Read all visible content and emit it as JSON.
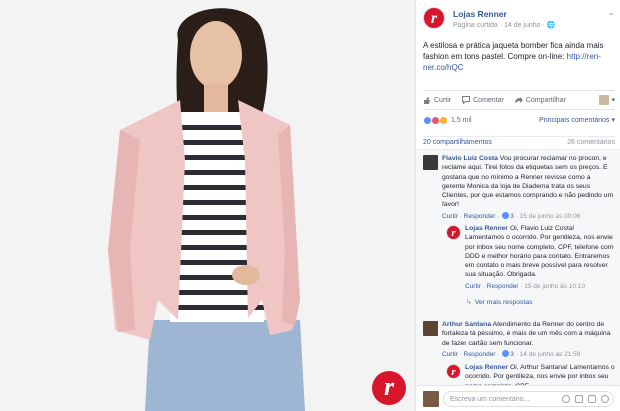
{
  "photo": {
    "brand_logo_letter": "r"
  },
  "post": {
    "page_name": "Lojas Renner",
    "page_avatar_letter": "r",
    "meta": "Página curtida · 14 de junho · 🌐",
    "text": "A estilosa e prática jaqueta bomber fica ainda mais fashion em tons pastel. Compre on-line: ",
    "link": "http://ren-ner.co/hQC"
  },
  "actions": {
    "like": "Curtir",
    "comment": "Comentar",
    "share": "Compartilhar"
  },
  "reactions": {
    "count": "1,5 mil",
    "sort": "Principais comentários ▾"
  },
  "stats": {
    "shares": "20 compartilhamentos",
    "comments": "26 comentários"
  },
  "comments": [
    {
      "author": "Flavio Luiz Costa",
      "text": "Vou procurar reclamar no procon, e reclame aqui. Tirei fotos da etiquetas sem os preços. E gostaria que no mínimo a Renner revisse como a gerente Monica da loja de Diadema trata os seus Clientes, por que estamos comprando e não pedindo um favor!",
      "like": "Curtir",
      "reply": "Responder",
      "likes": "3",
      "time": "15 de junho às 00:06"
    },
    {
      "author": "Lojas Renner",
      "avatar_letter": "r",
      "text": "Oi, Flavio Luiz Costa! Lamentamos o ocorrido. Por gentileza, nos envie por inbox seu nome completo, CPF, telefone com DDD e melhor horário para contato. Entraremos em contato o mais breve possível para resolver sua situação. Obrigada.",
      "like": "Curtir",
      "reply": "Responder",
      "time": "15 de junho às 10:10"
    },
    {
      "more_replies": "Ver mais respostas"
    },
    {
      "author": "Arthur Santana",
      "text": "Atendimento da Renner do centro de fortaleza tá péssimo, é mais de um mês com a máquina de fazer cartão sem funcionar.",
      "like": "Curtir",
      "reply": "Responder",
      "likes": "3",
      "time": "14 de junho às 21:59"
    },
    {
      "author": "Lojas Renner",
      "avatar_letter": "r",
      "text": "Oi, Arthur Santana! Lamentamos o ocorrido. Por gentileza, nos envie por inbox seu nome completo, CPF,"
    }
  ],
  "composer": {
    "placeholder": "Escreva um comentário..."
  }
}
